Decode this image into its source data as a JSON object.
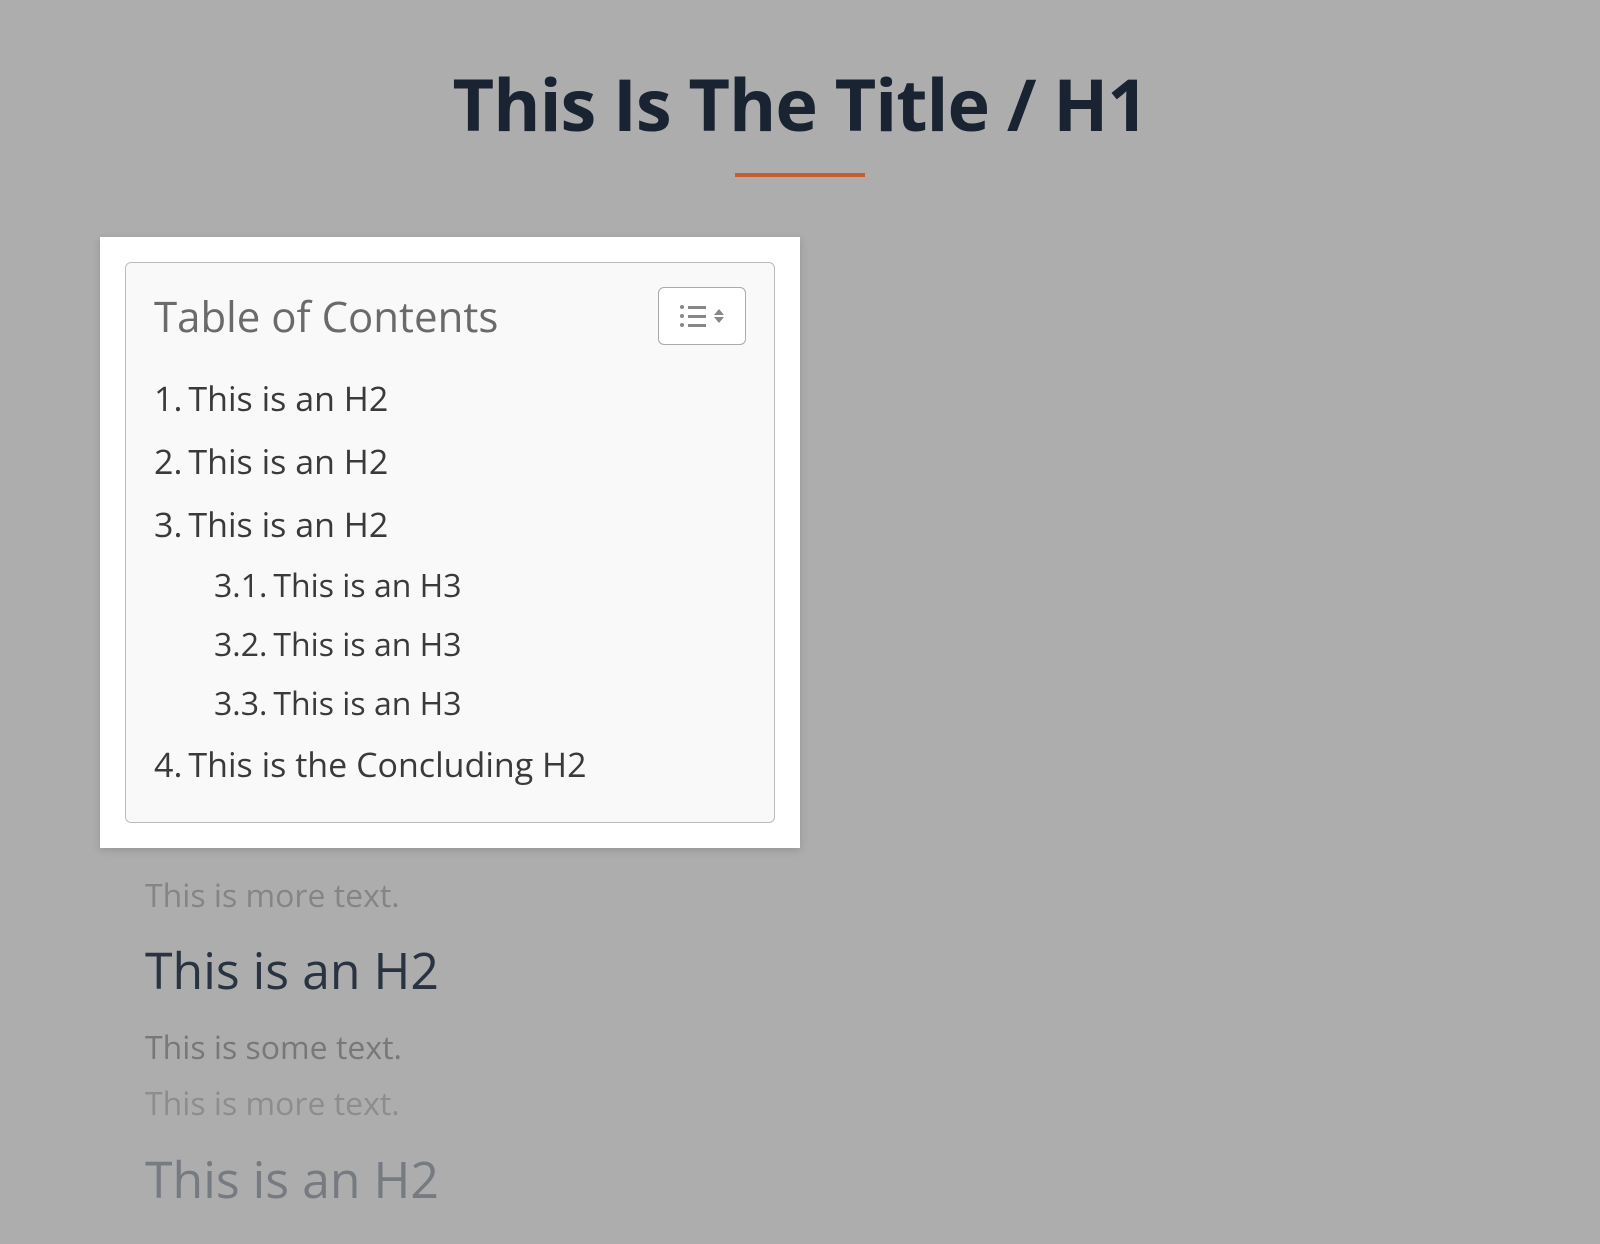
{
  "title": "This Is The Title / H1",
  "toc": {
    "heading": "Table of Contents",
    "items": [
      {
        "num": "1.",
        "label": "This is an H2",
        "level": 1
      },
      {
        "num": "2.",
        "label": "This is an H2",
        "level": 1
      },
      {
        "num": "3.",
        "label": "This is an H2",
        "level": 1
      },
      {
        "num": "3.1.",
        "label": "This is an H3",
        "level": 2
      },
      {
        "num": "3.2.",
        "label": "This is an H3",
        "level": 2
      },
      {
        "num": "3.3.",
        "label": "This is an H3",
        "level": 2
      },
      {
        "num": "4.",
        "label": "This is the Concluding H2",
        "level": 1
      }
    ]
  },
  "body": {
    "text_more_1": "This is more text.",
    "h2_1": "This is an H2",
    "text_some_1": "This is some text.",
    "text_more_2": "This is more text.",
    "h2_2": "This is an H2"
  }
}
